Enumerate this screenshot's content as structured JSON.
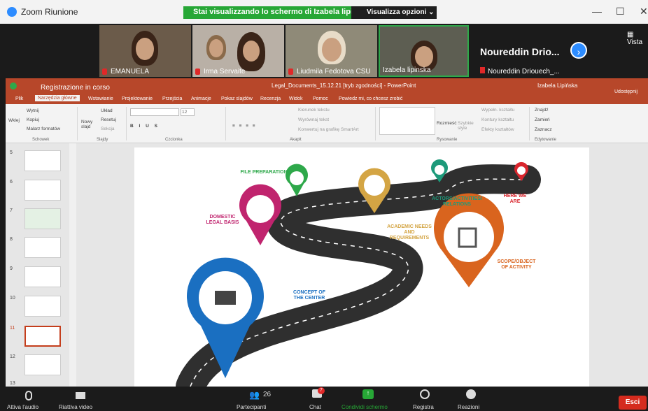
{
  "zoom": {
    "title": "Zoom Riunione",
    "share_message": "Stai visualizzando lo schermo di Izabela lipinska",
    "view_options": "Visualizza opzioni",
    "vista": "Vista"
  },
  "participants": [
    {
      "name": "EMANUELA"
    },
    {
      "name": "Irma Servaite"
    },
    {
      "name": "Liudmila Fedotova CSU"
    },
    {
      "name": "Izabela lipinska"
    }
  ],
  "speaker": {
    "name_big": "Noureddin Drio...",
    "name_small": "Noureddin Driouech_..."
  },
  "ppt": {
    "recording": "Registrazione in corso",
    "doc_title": "Legal_Documents_15.12.21 [tryb zgodności] - PowerPoint",
    "user": "Izabela Lipińska",
    "share": "Udostępnij",
    "tabs": [
      "Plik",
      "Narzędzia główne",
      "Wstawianie",
      "Projektowanie",
      "Przejścia",
      "Animacje",
      "Pokaz slajdów",
      "Recenzja",
      "Widok",
      "Pomoc",
      "Powiedz mi, co chcesz zrobić"
    ],
    "ribbon": {
      "paste": "Wklej",
      "cut": "Wytnij",
      "copy": "Kopiuj",
      "format": "Malarz formatów",
      "new_slide": "Nowy slajd",
      "layout": "Układ",
      "reset": "Resetuj",
      "section": "Sekcja",
      "font_size": "12",
      "text_dir": "Kierunek tekstu",
      "align_text": "Wyrównaj tekst",
      "smartart": "Konwertuj na grafikę SmartArt",
      "arrange": "Rozmieść",
      "styles": "Szybkie style",
      "fill": "Wypełn. kształtu",
      "outline": "Kontury kształtu",
      "effects": "Efekty kształtów",
      "find": "Znajdź",
      "replace": "Zamień",
      "select": "Zaznacz",
      "groups": [
        "Schowek",
        "Slajdy",
        "Czcionka",
        "Akapit",
        "Rysowanie",
        "Edytowanie"
      ]
    }
  },
  "slides": [
    "5",
    "6",
    "7",
    "8",
    "9",
    "10",
    "11",
    "12",
    "13"
  ],
  "slide_labels": {
    "file": "FILE PREPARATION",
    "domestic": "DOMESTIC LEGAL BASIS",
    "academic": "ACADEMIC NEEDS AND REQUIREMENTS",
    "actors": "ACTORS/ACTIVITIES/ RELATIONS",
    "here": "HERE WE ARE",
    "scope": "SCOPE/OBJECT OF ACTIVITY",
    "concept": "CONCEPT OF THE CENTER"
  },
  "bottom": {
    "audio": "Attiva l'audio",
    "video": "Riattiva video",
    "count": "26",
    "participants": "Partecipanti",
    "chat": "Chat",
    "chat_badge": "7",
    "share": "Condividi schermo",
    "record": "Registra",
    "reactions": "Reazioni",
    "leave": "Esci"
  },
  "colors": {
    "ppt": "#b7472a",
    "green": "#27a736",
    "blue": "#1a6fc1",
    "orange": "#d9641e",
    "magenta": "#c0246e",
    "teal": "#1d9a7a",
    "gold": "#d4a544",
    "red": "#d9262e"
  }
}
